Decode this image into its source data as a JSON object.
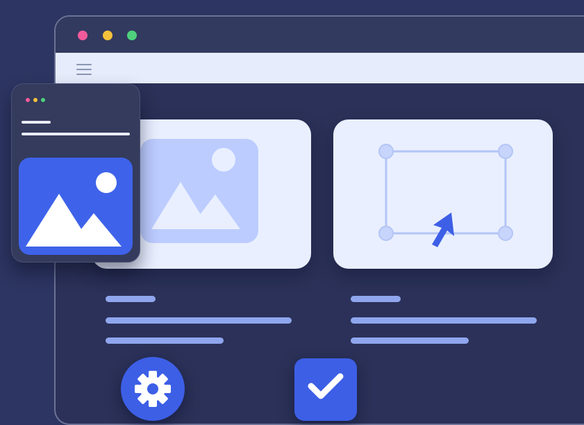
{
  "window": {
    "controls": [
      "close-dot",
      "minimize-dot",
      "maximize-dot"
    ],
    "menu_icon": "hamburger-icon"
  },
  "cards": [
    {
      "icon": "image-icon"
    },
    {
      "icon": "selection-box-icon",
      "cursor": "pointer-cursor-icon"
    }
  ],
  "mini_window": {
    "icon": "image-icon"
  },
  "buttons": [
    {
      "icon": "gear-icon"
    },
    {
      "icon": "checkmark-icon"
    }
  ],
  "colors": {
    "background": "#2d3562",
    "accent": "#3d5fe6",
    "card": "#e9efff",
    "line": "#8fa6ee",
    "dot_red": "#f05a9b",
    "dot_yellow": "#f3c23c",
    "dot_green": "#4fd07d"
  }
}
